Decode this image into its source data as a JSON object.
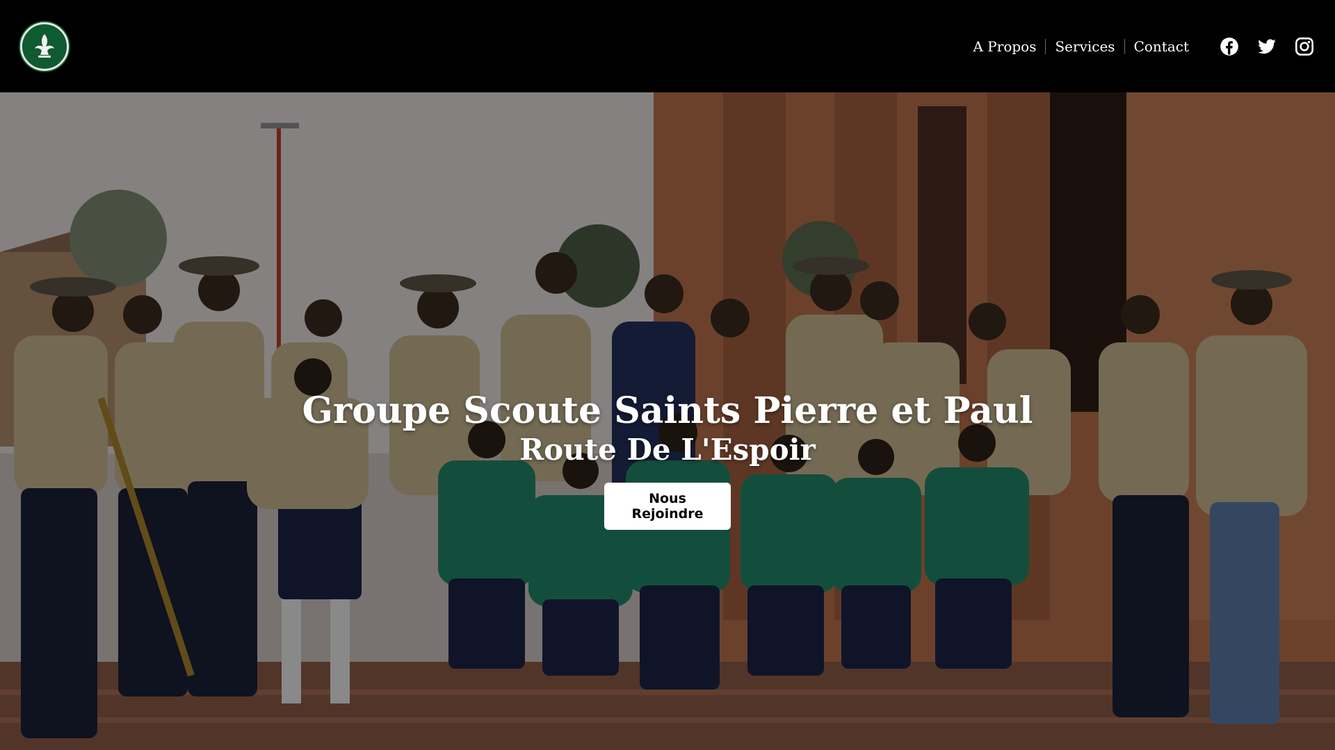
{
  "header": {
    "nav": [
      {
        "label": "A Propos"
      },
      {
        "label": "Services"
      },
      {
        "label": "Contact"
      }
    ],
    "socials": [
      {
        "icon": "facebook-icon"
      },
      {
        "icon": "twitter-icon"
      },
      {
        "icon": "instagram-icon"
      }
    ],
    "logo_icon": "fleur-de-lis-icon"
  },
  "hero": {
    "title": "Groupe Scoute Saints Pierre et Paul",
    "subtitle": "Route De L'Espoir",
    "cta_label": "Nous Rejoindre",
    "image": "group-photo"
  },
  "colors": {
    "header_bg": "#000000",
    "logo_green": "#0f5a2e",
    "cta_bg": "#ffffff",
    "cta_text": "#000000"
  }
}
